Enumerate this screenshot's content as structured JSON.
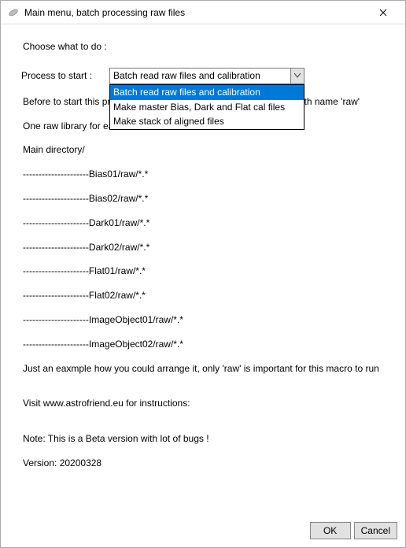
{
  "window": {
    "title": "Main menu, batch processing raw files"
  },
  "content": {
    "choose_label": "Choose what to do :",
    "process_label": "Process to start :",
    "combo_selected": "Batch read raw files and calibration",
    "dropdown": [
      "Batch read raw files and calibration",
      "Make master Bias, Dark and Flat cal files",
      "Make stack of aligned files"
    ],
    "lines": {
      "before_start": "Before to start this process, save each set of raw files in a library with name 'raw'",
      "one_lib": "One raw library for each set of raw files",
      "main_dir": "Main directory/",
      "l1": "---------------------Bias01/raw/*.*",
      "l2": "---------------------Bias02/raw/*.*",
      "l3": "---------------------Dark01/raw/*.*",
      "l4": "---------------------Dark02/raw/*.*",
      "l5": "---------------------Flat01/raw/*.*",
      "l6": "---------------------Flat02/raw/*.*",
      "l7": "---------------------ImageObject01/raw/*.*",
      "l8": "---------------------ImageObject02/raw/*.*",
      "example": "Just an eaxmple how you could arrange it, only 'raw' is important for this macro to run",
      "visit": "Visit www.astrofriend.eu for instructions:",
      "beta": "Note: This is a Beta version with lot of bugs !",
      "version": "Version: 20200328"
    }
  },
  "footer": {
    "ok": "OK",
    "cancel": "Cancel"
  }
}
